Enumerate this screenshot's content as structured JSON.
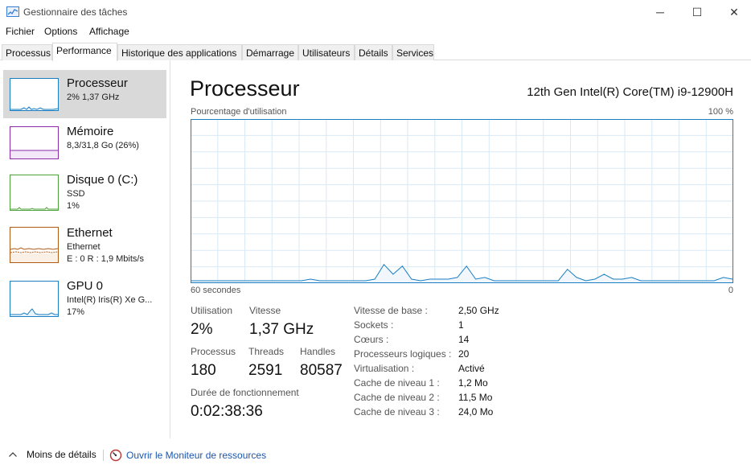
{
  "window": {
    "title": "Gestionnaire des tâches",
    "controls": {
      "minimize": "─",
      "maximize": "☐",
      "close": "✕"
    }
  },
  "menu": [
    "Fichier",
    "Options",
    "Affichage"
  ],
  "tabs": [
    {
      "label": "Processus",
      "active": false
    },
    {
      "label": "Performance",
      "active": true
    },
    {
      "label": "Historique des applications",
      "active": false
    },
    {
      "label": "Démarrage",
      "active": false
    },
    {
      "label": "Utilisateurs",
      "active": false
    },
    {
      "label": "Détails",
      "active": false
    },
    {
      "label": "Services",
      "active": false
    }
  ],
  "sidebar": [
    {
      "title": "Processeur",
      "lines": [
        "2% 1,37 GHz"
      ],
      "color": "#1b7ec2",
      "fill": "#e7f2fb",
      "selected": true,
      "icon": "cpu-graph-icon"
    },
    {
      "title": "Mémoire",
      "lines": [
        "8,3/31,8 Go (26%)"
      ],
      "color": "#8b2ca8",
      "fill": "#f3e8f7",
      "selected": false,
      "icon": "memory-graph-icon"
    },
    {
      "title": "Disque 0 (C:)",
      "lines": [
        "SSD",
        "1%"
      ],
      "color": "#4da13a",
      "fill": "#eef7ea",
      "selected": false,
      "icon": "disk-graph-icon"
    },
    {
      "title": "Ethernet",
      "lines": [
        "Ethernet",
        "E : 0 R : 1,9 Mbits/s"
      ],
      "color": "#b05a17",
      "fill": "#fbf0e6",
      "selected": false,
      "icon": "ethernet-graph-icon"
    },
    {
      "title": "GPU 0",
      "lines": [
        "Intel(R) Iris(R) Xe G...",
        "17%"
      ],
      "color": "#1b7ec2",
      "fill": "#e7f2fb",
      "selected": false,
      "icon": "gpu-graph-icon"
    }
  ],
  "main": {
    "title": "Processeur",
    "model": "12th Gen Intel(R) Core(TM) i9-12900H",
    "graph": {
      "label": "Pourcentage d'utilisation",
      "max_label": "100 %",
      "time_label": "60 secondes",
      "min_label": "0",
      "line_color": "#1b7ec2",
      "fill_color": "#f1f7fc",
      "grid_color": "#d9eaf6"
    },
    "stats": {
      "utilisation": {
        "label": "Utilisation",
        "value": "2%"
      },
      "vitesse": {
        "label": "Vitesse",
        "value": "1,37 GHz"
      },
      "processus": {
        "label": "Processus",
        "value": "180"
      },
      "threads": {
        "label": "Threads",
        "value": "2591"
      },
      "handles": {
        "label": "Handles",
        "value": "80587"
      },
      "uptime": {
        "label": "Durée de fonctionnement",
        "value": "0:02:38:36"
      }
    },
    "specs": [
      {
        "label": "Vitesse de base :",
        "value": "2,50 GHz"
      },
      {
        "label": "Sockets :",
        "value": "1"
      },
      {
        "label": "Cœurs :",
        "value": "14"
      },
      {
        "label": "Processeurs logiques :",
        "value": "20"
      },
      {
        "label": "Virtualisation :",
        "value": "Activé"
      },
      {
        "label": "Cache de niveau 1 :",
        "value": "1,2 Mo"
      },
      {
        "label": "Cache de niveau 2 :",
        "value": "11,5 Mo"
      },
      {
        "label": "Cache de niveau 3 :",
        "value": "24,0 Mo"
      }
    ]
  },
  "chart_data": {
    "type": "area",
    "series": [
      {
        "values": [
          1,
          1,
          1,
          1,
          1,
          1,
          1,
          1,
          1,
          1,
          1,
          1,
          1,
          2,
          1,
          1,
          1,
          1,
          1,
          1,
          2,
          11,
          5,
          10,
          2,
          1,
          2,
          2,
          2,
          3,
          10,
          2,
          3,
          1,
          1,
          1,
          1,
          1,
          1,
          1,
          1,
          8,
          3,
          1,
          2,
          5,
          2,
          2,
          3,
          1,
          1,
          1,
          1,
          1,
          1,
          1,
          1,
          1,
          3,
          2
        ]
      }
    ],
    "ylim": [
      0,
      100
    ],
    "grid": true
  },
  "footer": {
    "less_details": "Moins de détails",
    "resource_monitor": "Ouvrir le Moniteur de ressources"
  }
}
